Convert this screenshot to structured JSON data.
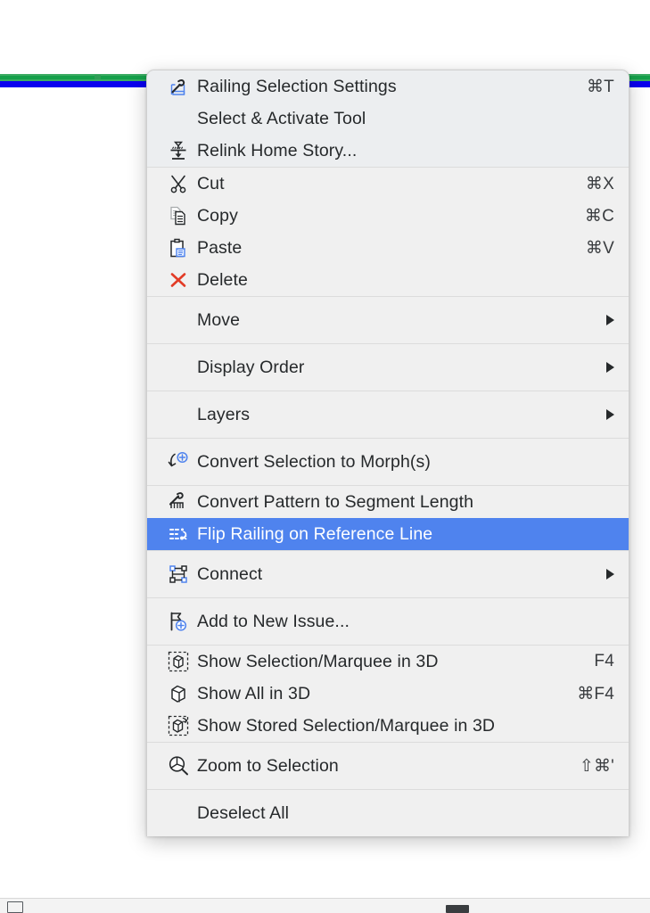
{
  "canvas": {
    "railing_green_color": "#15a04a",
    "railing_blue_color": "#0a00ee"
  },
  "context_menu": {
    "highlight_color": "#4f83ee",
    "background_color": "#f0f0f0",
    "sections": [
      {
        "tinted": true,
        "items": [
          {
            "label": "Railing Selection Settings",
            "icon": "railing-settings-icon",
            "shortcut": "⌘T",
            "submenu": false,
            "highlighted": false
          },
          {
            "label": "Select & Activate Tool",
            "icon": "",
            "shortcut": "",
            "submenu": false,
            "highlighted": false
          },
          {
            "label": "Relink Home Story...",
            "icon": "relink-home-story-icon",
            "shortcut": "",
            "submenu": false,
            "highlighted": false
          }
        ]
      },
      {
        "tinted": false,
        "items": [
          {
            "label": "Cut",
            "icon": "scissors-icon",
            "shortcut": "⌘X",
            "submenu": false,
            "highlighted": false
          },
          {
            "label": "Copy",
            "icon": "copy-icon",
            "shortcut": "⌘C",
            "submenu": false,
            "highlighted": false
          },
          {
            "label": "Paste",
            "icon": "clipboard-paste-icon",
            "shortcut": "⌘V",
            "submenu": false,
            "highlighted": false
          },
          {
            "label": "Delete",
            "icon": "delete-x-icon",
            "shortcut": "",
            "submenu": false,
            "highlighted": false
          }
        ]
      },
      {
        "tinted": false,
        "items": [
          {
            "label": "Move",
            "icon": "",
            "shortcut": "",
            "submenu": true,
            "highlighted": false
          }
        ]
      },
      {
        "tinted": false,
        "items": [
          {
            "label": "Display Order",
            "icon": "",
            "shortcut": "",
            "submenu": true,
            "highlighted": false
          }
        ]
      },
      {
        "tinted": false,
        "items": [
          {
            "label": "Layers",
            "icon": "",
            "shortcut": "",
            "submenu": true,
            "highlighted": false
          }
        ]
      },
      {
        "tinted": false,
        "items": [
          {
            "label": "Convert Selection to Morph(s)",
            "icon": "convert-morph-icon",
            "shortcut": "",
            "submenu": false,
            "highlighted": false
          }
        ]
      },
      {
        "tinted": false,
        "items": [
          {
            "label": "Convert Pattern to Segment Length",
            "icon": "convert-pattern-icon",
            "shortcut": "",
            "submenu": false,
            "highlighted": false
          },
          {
            "label": "Flip Railing on Reference Line",
            "icon": "flip-railing-icon",
            "shortcut": "",
            "submenu": false,
            "highlighted": true
          }
        ]
      },
      {
        "tinted": false,
        "items": [
          {
            "label": "Connect",
            "icon": "connect-nodes-icon",
            "shortcut": "",
            "submenu": true,
            "highlighted": false
          }
        ]
      },
      {
        "tinted": false,
        "items": [
          {
            "label": "Add to New Issue...",
            "icon": "add-issue-flag-icon",
            "shortcut": "",
            "submenu": false,
            "highlighted": false
          }
        ]
      },
      {
        "tinted": false,
        "items": [
          {
            "label": "Show Selection/Marquee in 3D",
            "icon": "cube-dashed-icon",
            "shortcut": "F4",
            "shortcut_small": true,
            "submenu": false,
            "highlighted": false
          },
          {
            "label": "Show All in 3D",
            "icon": "cube-icon",
            "shortcut": "⌘F4",
            "shortcut_small": true,
            "submenu": false,
            "highlighted": false
          },
          {
            "label": "Show Stored Selection/Marquee in 3D",
            "icon": "cube-stored-icon",
            "shortcut": "",
            "submenu": false,
            "highlighted": false
          }
        ]
      },
      {
        "tinted": false,
        "items": [
          {
            "label": "Zoom to Selection",
            "icon": "zoom-selection-icon",
            "shortcut": "⇧⌘'",
            "submenu": false,
            "highlighted": false
          }
        ]
      },
      {
        "tinted": false,
        "items": [
          {
            "label": "Deselect All",
            "icon": "",
            "shortcut": "",
            "submenu": false,
            "highlighted": false
          }
        ]
      }
    ]
  }
}
